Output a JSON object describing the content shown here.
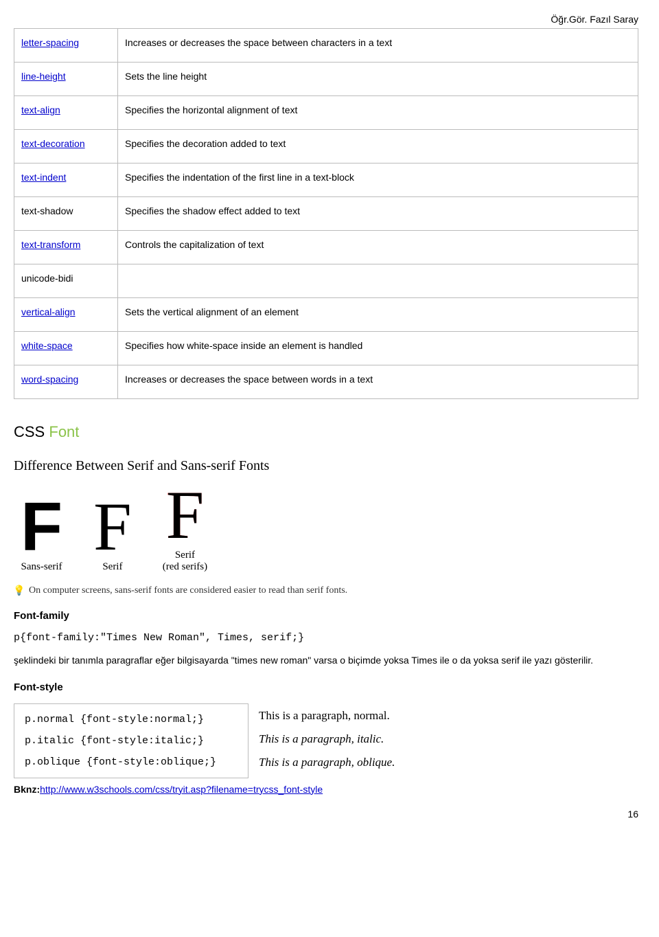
{
  "header": {
    "author": "Öğr.Gör. Fazıl Saray"
  },
  "props_table": [
    {
      "name": "letter-spacing",
      "link": true,
      "desc": "Increases or decreases the space between characters in a text"
    },
    {
      "name": "line-height",
      "link": true,
      "desc": "Sets the line height"
    },
    {
      "name": "text-align",
      "link": true,
      "desc": "Specifies the horizontal alignment of text"
    },
    {
      "name": "text-decoration",
      "link": true,
      "desc": "Specifies the decoration added to text"
    },
    {
      "name": "text-indent",
      "link": true,
      "desc": "Specifies the indentation of the first line in a text-block"
    },
    {
      "name": "text-shadow",
      "link": false,
      "desc": "Specifies the shadow effect added to text"
    },
    {
      "name": "text-transform",
      "link": true,
      "desc": "Controls the capitalization of text"
    },
    {
      "name": "unicode-bidi",
      "link": false,
      "desc": ""
    },
    {
      "name": "vertical-align",
      "link": true,
      "desc": "Sets the vertical alignment of an element"
    },
    {
      "name": "white-space",
      "link": true,
      "desc": "Specifies how white-space inside an element is handled"
    },
    {
      "name": "word-spacing",
      "link": true,
      "desc": "Increases or decreases the space between words in a text"
    }
  ],
  "heading": {
    "css": "CSS",
    "font": "Font"
  },
  "serif_diff": "Difference Between Serif and Sans-serif Fonts",
  "specimens": {
    "glyph": "F",
    "sans": "Sans-serif",
    "serif": "Serif",
    "serif_red": "Serif",
    "serif_red_sub": "(red serifs)"
  },
  "tip": "On computer screens, sans-serif fonts are considered easier to read than serif fonts.",
  "font_family": {
    "title": "Font-family",
    "code": "p{font-family:\"Times New Roman\", Times, serif;}",
    "para": "şeklindeki bir tanımla paragraflar eğer bilgisayarda \"times new roman\" varsa o biçimde yoksa Times ile o da yoksa serif ile yazı gösterilir."
  },
  "font_style": {
    "title": "Font-style",
    "rows": [
      {
        "code": "p.normal {font-style:normal;}",
        "out": "This is a paragraph, normal.",
        "cls": ""
      },
      {
        "code": "p.italic {font-style:italic;}",
        "out": "This is a paragraph, italic.",
        "cls": "fs-italic"
      },
      {
        "code": "p.oblique {font-style:oblique;}",
        "out": "This is a paragraph, oblique.",
        "cls": "fs-oblique"
      }
    ]
  },
  "bknz": {
    "label": "Bknz:",
    "url": "http://www.w3schools.com/css/tryit.asp?filename=trycss_font-style"
  },
  "page_number": "16"
}
